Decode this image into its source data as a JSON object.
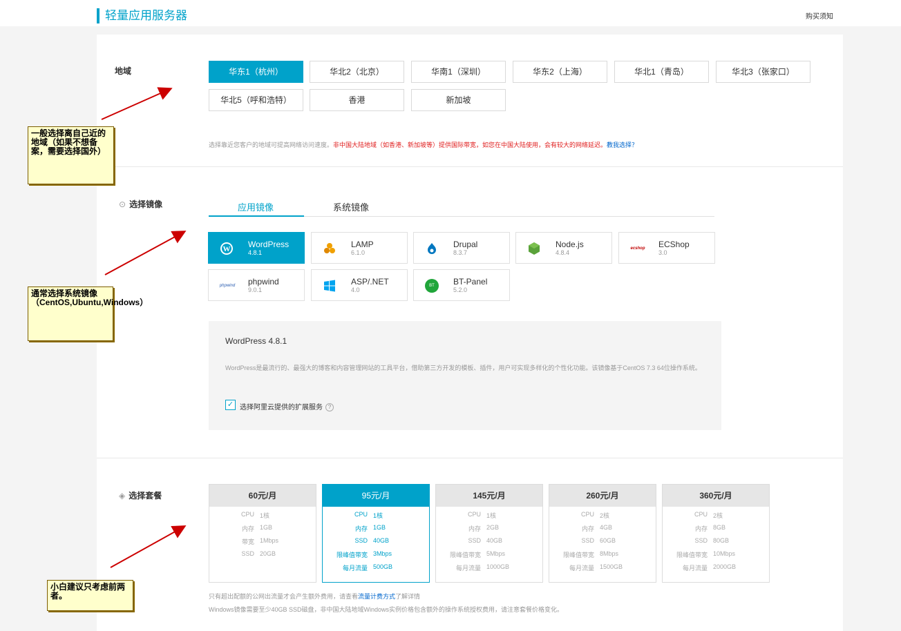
{
  "header": {
    "title": "轻量应用服务器",
    "buy_link": "购买须知"
  },
  "region": {
    "label": "地域",
    "options": [
      "华东1（杭州）",
      "华北2（北京）",
      "华南1（深圳）",
      "华东2（上海）",
      "华北1（青岛）",
      "华北3（张家口）",
      "华北5（呼和浩特）",
      "香港",
      "新加坡"
    ],
    "selected": "华东1（杭州）",
    "hint_gray": "选择靠近您客户的地域可提高网络访问速度。",
    "hint_red": "非中国大陆地域（如香港、新加坡等）提供国际带宽，如您在中国大陆使用，会有较大的网络延迟。",
    "hint_link": "教我选择？"
  },
  "image": {
    "label": "选择镜像",
    "tabs": [
      "应用镜像",
      "系统镜像"
    ],
    "active_tab": "应用镜像",
    "items": [
      {
        "name": "WordPress",
        "version": "4.8.1",
        "icon": "wordpress-icon"
      },
      {
        "name": "LAMP",
        "version": "6.1.0",
        "icon": "lamp-icon"
      },
      {
        "name": "Drupal",
        "version": "8.3.7",
        "icon": "drupal-icon"
      },
      {
        "name": "Node.js",
        "version": "4.8.4",
        "icon": "nodejs-icon"
      },
      {
        "name": "ECShop",
        "version": "3.0",
        "icon": "ecshop-icon",
        "logo_text": "ecshop"
      },
      {
        "name": "phpwind",
        "version": "9.0.1",
        "icon": "phpwind-icon",
        "logo_text": "phpwind"
      },
      {
        "name": "ASP/.NET",
        "version": "4.0",
        "icon": "windows-icon"
      },
      {
        "name": "BT-Panel",
        "version": "5.2.0",
        "icon": "bt-panel-icon",
        "logo_text": "BT"
      }
    ],
    "selected": "WordPress",
    "detail": {
      "title": "WordPress 4.8.1",
      "description": "WordPress是最流行的、最强大的博客和内容管理网站的工具平台，借助第三方开发的模板、插件，用户可实现多样化的个性化功能。该镜像基于CentOS 7.3 64位操作系统。",
      "checkbox_label": "选择阿里云提供的扩展服务",
      "checkbox_checked": true
    }
  },
  "plan": {
    "label": "选择套餐",
    "items": [
      {
        "price": "60元/月",
        "specs": [
          [
            "CPU",
            "1核"
          ],
          [
            "内存",
            "1GB"
          ],
          [
            "带宽",
            "1Mbps"
          ],
          [
            "SSD",
            "20GB"
          ]
        ]
      },
      {
        "price": "95元/月",
        "specs": [
          [
            "CPU",
            "1核"
          ],
          [
            "内存",
            "1GB"
          ],
          [
            "SSD",
            "40GB"
          ],
          [
            "限峰值带宽",
            "3Mbps"
          ],
          [
            "每月流量",
            "500GB"
          ]
        ]
      },
      {
        "price": "145元/月",
        "specs": [
          [
            "CPU",
            "1核"
          ],
          [
            "内存",
            "2GB"
          ],
          [
            "SSD",
            "40GB"
          ],
          [
            "限峰值带宽",
            "5Mbps"
          ],
          [
            "每月流量",
            "1000GB"
          ]
        ]
      },
      {
        "price": "260元/月",
        "specs": [
          [
            "CPU",
            "2核"
          ],
          [
            "内存",
            "4GB"
          ],
          [
            "SSD",
            "60GB"
          ],
          [
            "限峰值带宽",
            "8Mbps"
          ],
          [
            "每月流量",
            "1500GB"
          ]
        ]
      },
      {
        "price": "360元/月",
        "specs": [
          [
            "CPU",
            "2核"
          ],
          [
            "内存",
            "8GB"
          ],
          [
            "SSD",
            "80GB"
          ],
          [
            "限峰值带宽",
            "10Mbps"
          ],
          [
            "每月流量",
            "2000GB"
          ]
        ]
      }
    ],
    "selected": "95元/月",
    "note1_pre": "只有超出配额的公网出流量才会产生额外费用，请查看",
    "note1_link": "流量计费方式",
    "note1_post": "了解详情",
    "note2": "Windows镜像需要至少40GB SSD磁盘，非中国大陆地域Windows实例价格包含额外的操作系统授权费用，请注意套餐价格变化。"
  },
  "annotations": [
    "一般选择离自己近的地域（如果不想备案，需要选择国外）",
    "通常选择系统镜像（CentOS,Ubuntu,Windows）",
    "小白建议只考虑前两者。"
  ],
  "colors": {
    "accent": "#00a2ca",
    "warning_text": "#e02020",
    "link": "#0066cc",
    "annotation_bg": "#ffffcc",
    "arrow": "#cc0000"
  }
}
